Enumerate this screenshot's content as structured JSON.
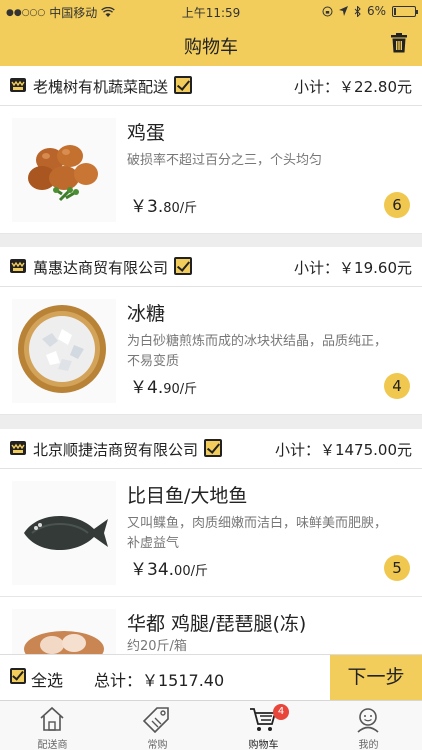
{
  "status_bar": {
    "carrier": "中国移动",
    "time": "上午11:59",
    "battery": "6%"
  },
  "navbar": {
    "title": "购物车"
  },
  "stores": [
    {
      "name": "老槐树有机蔬菜配送",
      "subtotal": "小计：￥22.80元",
      "items": [
        {
          "name": "鸡蛋",
          "description": "破损率不超过百分之三，个头均匀",
          "price_main": "￥3.",
          "price_small": "80/斤",
          "quantity": "6"
        }
      ]
    },
    {
      "name": "萬惠达商贸有限公司",
      "subtotal": "小计：￥19.60元",
      "items": [
        {
          "name": "冰糖",
          "description": "为白砂糖煎炼而成的冰块状结晶，品质纯正，不易变质",
          "price_main": "￥4.",
          "price_small": "90/斤",
          "quantity": "4"
        }
      ]
    },
    {
      "name": "北京顺捷洁商贸有限公司",
      "subtotal": "小计：￥1475.00元",
      "items": [
        {
          "name": "比目鱼/大地鱼",
          "description": "又叫鲽鱼，肉质细嫩而洁白，味鲜美而肥腴，补虚益气",
          "price_main": "￥34.",
          "price_small": "00/斤",
          "quantity": "5"
        },
        {
          "name": "华都 鸡腿/琵琶腿(冻)",
          "description": "约20斤/箱",
          "price_main": "",
          "price_small": "",
          "quantity": ""
        }
      ]
    }
  ],
  "totalbar": {
    "select_all": "全选",
    "total": "总计：￥1517.40",
    "next": "下一步"
  },
  "tabs": [
    {
      "label": "配送商",
      "icon": "home-icon"
    },
    {
      "label": "常购",
      "icon": "tag-icon"
    },
    {
      "label": "购物车",
      "icon": "cart-icon",
      "badge": "4",
      "active": true
    },
    {
      "label": "我的",
      "icon": "user-icon"
    }
  ]
}
